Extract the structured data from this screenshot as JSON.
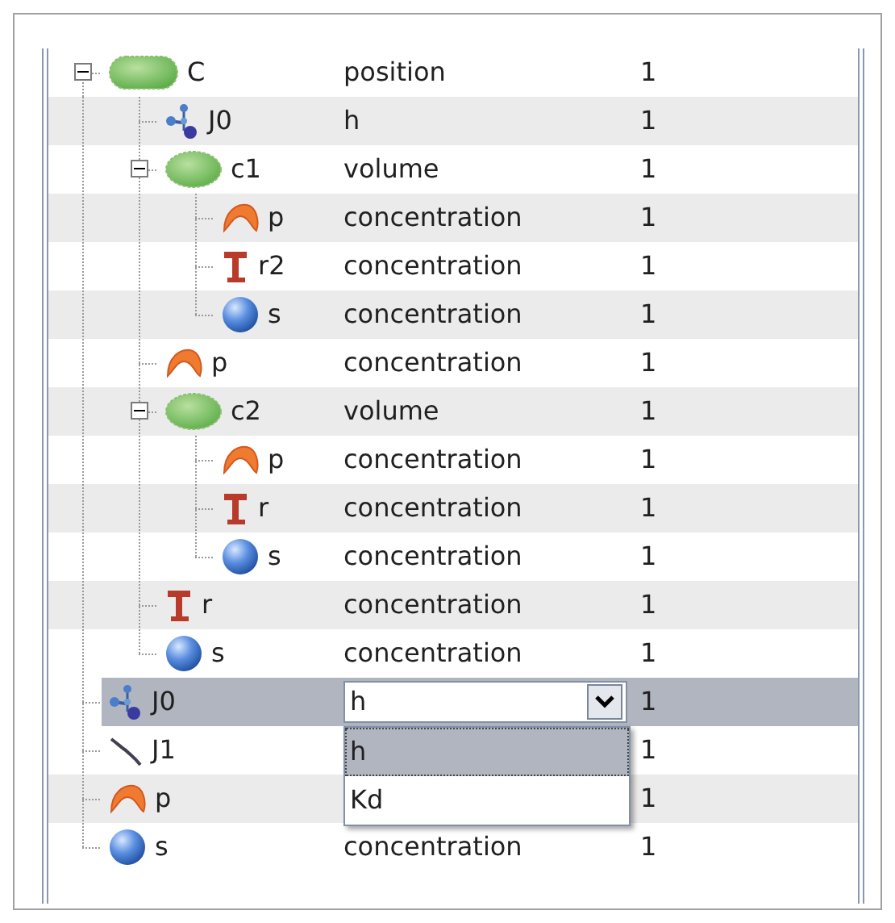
{
  "tree": [
    {
      "label": "C",
      "kind": "compartment",
      "expanded": true,
      "selected": false,
      "column_2": "position",
      "column_3": "1",
      "children": [
        {
          "label": "J0",
          "kind": "junction",
          "selected": false,
          "column_2": "h",
          "column_3": "1"
        },
        {
          "label": "c1",
          "kind": "compartment",
          "expanded": true,
          "selected": false,
          "column_2": "volume",
          "column_3": "1",
          "children": [
            {
              "label": "p",
              "kind": "protein",
              "selected": false,
              "column_2": "concentration",
              "column_3": "1"
            },
            {
              "label": "r2",
              "kind": "receptor",
              "selected": false,
              "column_2": "concentration",
              "column_3": "1"
            },
            {
              "label": "s",
              "kind": "species",
              "selected": false,
              "column_2": "concentration",
              "column_3": "1"
            }
          ]
        },
        {
          "label": "p",
          "kind": "protein",
          "selected": false,
          "column_2": "concentration",
          "column_3": "1"
        },
        {
          "label": "c2",
          "kind": "compartment",
          "expanded": true,
          "selected": false,
          "column_2": "volume",
          "column_3": "1",
          "children": [
            {
              "label": "p",
              "kind": "protein",
              "selected": false,
              "column_2": "concentration",
              "column_3": "1"
            },
            {
              "label": "r",
              "kind": "receptor",
              "selected": false,
              "column_2": "concentration",
              "column_3": "1"
            },
            {
              "label": "s",
              "kind": "species",
              "selected": false,
              "column_2": "concentration",
              "column_3": "1"
            }
          ]
        },
        {
          "label": "r",
          "kind": "receptor",
          "selected": false,
          "column_2": "concentration",
          "column_3": "1"
        },
        {
          "label": "s",
          "kind": "species",
          "selected": false,
          "column_2": "concentration",
          "column_3": "1"
        }
      ]
    },
    {
      "label": "J0",
      "kind": "junction",
      "selected": true,
      "editor": {
        "value": "h",
        "options": [
          {
            "label": "h",
            "selected": true
          },
          {
            "label": "Kd",
            "selected": false
          }
        ]
      },
      "column_3": "1"
    },
    {
      "label": "J1",
      "kind": "connector",
      "selected": false,
      "column_3": "1"
    },
    {
      "label": "p",
      "kind": "protein",
      "selected": false,
      "column_3": "1"
    },
    {
      "label": "s",
      "kind": "species",
      "selected": false,
      "column_2": "concentration",
      "column_3": "1"
    }
  ]
}
